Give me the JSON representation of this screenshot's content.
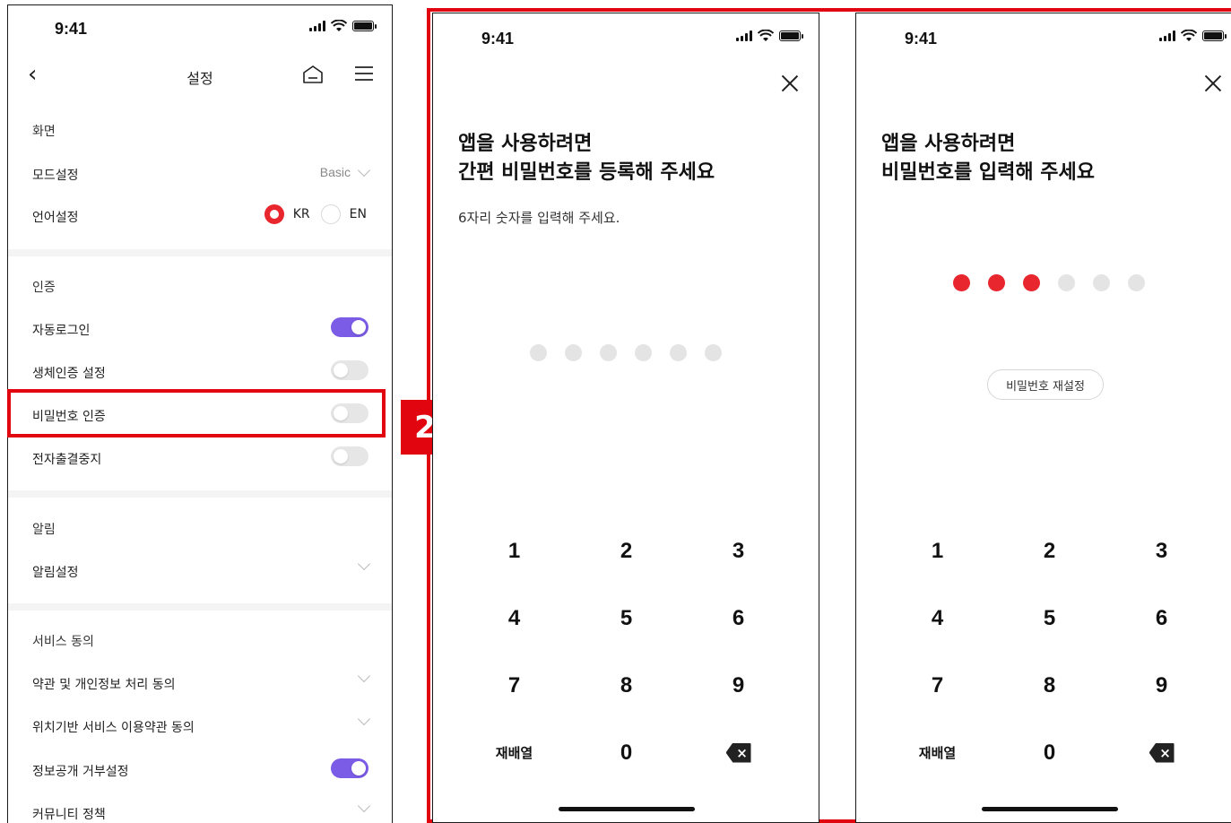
{
  "status_time": "9:41",
  "settings": {
    "title": "설정",
    "sections": {
      "screen": "화면",
      "auth": "인증",
      "notice": "알림",
      "service": "서비스 동의"
    },
    "mode_label": "모드설정",
    "mode_value": "Basic",
    "lang_label": "언어설정",
    "lang_kr": "KR",
    "lang_en": "EN",
    "auto_login": "자동로그인",
    "bio_auth": "생체인증 설정",
    "pin_auth": "비밀번호 인증",
    "e_payment_stop": "전자출결중지",
    "notice_setting": "알림설정",
    "terms_privacy": "약관 및 개인정보 처리 동의",
    "location_terms": "위치기반 서비스 이용약관 동의",
    "info_disclosure": "정보공개 거부설정",
    "community_policy": "커뮤니티 정책"
  },
  "badge": "2",
  "register": {
    "heading_line1": "앱을 사용하려면",
    "heading_line2": "간편 비밀번호를 등록해 주세요",
    "sub": "6자리 숫자를 입력해 주세요.",
    "filled": 0,
    "total": 6
  },
  "enter": {
    "heading_line1": "앱을 사용하려면",
    "heading_line2": "비밀번호를 입력해 주세요",
    "filled": 3,
    "total": 6,
    "reset": "비밀번호 재설정"
  },
  "keypad": {
    "k1": "1",
    "k2": "2",
    "k3": "3",
    "k4": "4",
    "k5": "5",
    "k6": "6",
    "k7": "7",
    "k8": "8",
    "k9": "9",
    "shuffle": "재배열",
    "k0": "0",
    "delete": "×"
  },
  "colors": {
    "accent_red": "#e8262d",
    "toggle_on": "#7b5ce6",
    "highlight": "#e0050f"
  },
  "toggles": {
    "auto_login": true,
    "bio_auth": false,
    "pin_auth": false,
    "e_payment_stop": false,
    "info_disclosure": true
  }
}
